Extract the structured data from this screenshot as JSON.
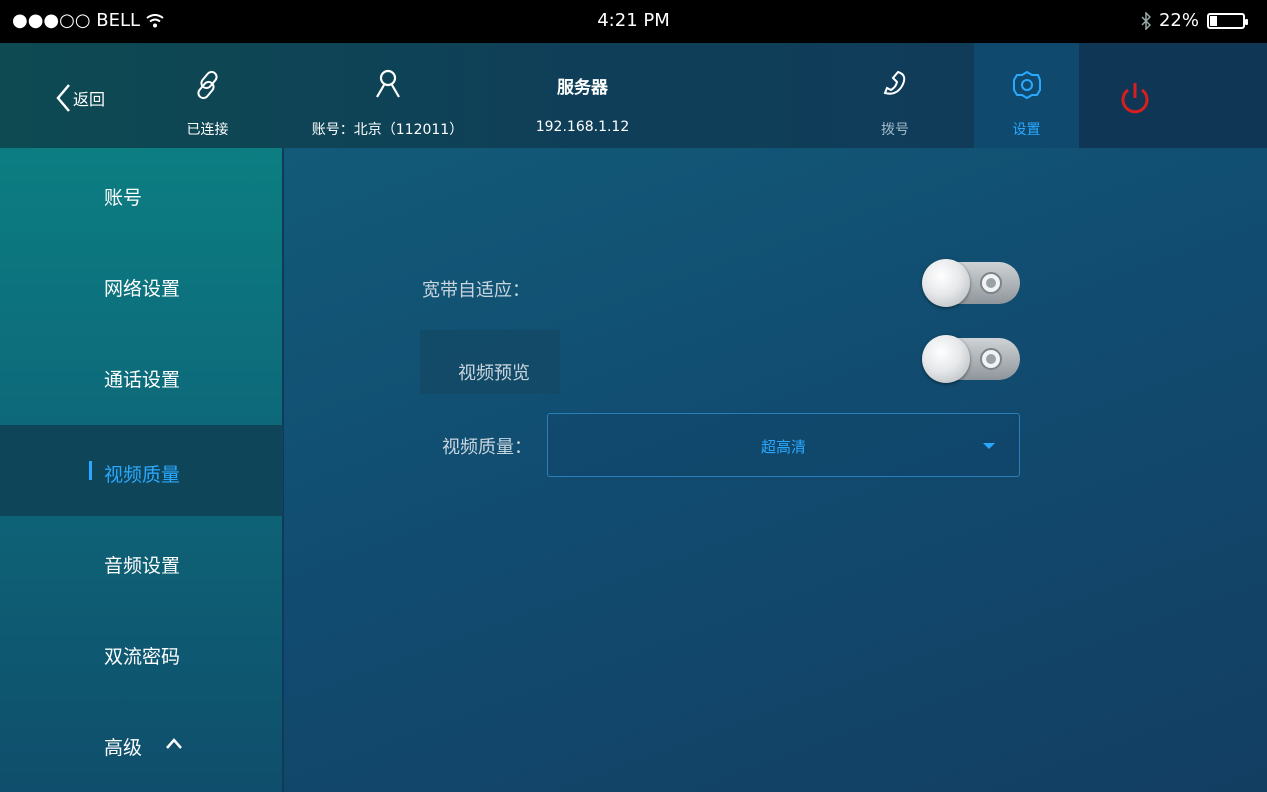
{
  "status_bar": {
    "carrier": "●●●○○ BELL",
    "time": "4:21 PM",
    "battery": "22%",
    "battery_level": 0.22
  },
  "topnav": {
    "back_label": "返回",
    "connection_label": "已连接",
    "account_label": "账号：北京（112011）",
    "server_title": "服务器",
    "server_ip": "192.168.1.12",
    "dial_label": "拨号",
    "settings_label": "设置"
  },
  "sidebar": {
    "items": [
      {
        "label": "账号"
      },
      {
        "label": "网络设置"
      },
      {
        "label": "通话设置"
      },
      {
        "label": "视频质量"
      },
      {
        "label": "音频设置"
      },
      {
        "label": "双流密码"
      },
      {
        "label": "高级"
      }
    ],
    "active_index": 3
  },
  "main": {
    "bandwidth_label": "宽带自适应：",
    "preview_label": "视频预览",
    "quality_label": "视频质量：",
    "quality_value": "超高清"
  },
  "colors": {
    "accent": "#2aa8ff",
    "power": "#d81e1e"
  }
}
